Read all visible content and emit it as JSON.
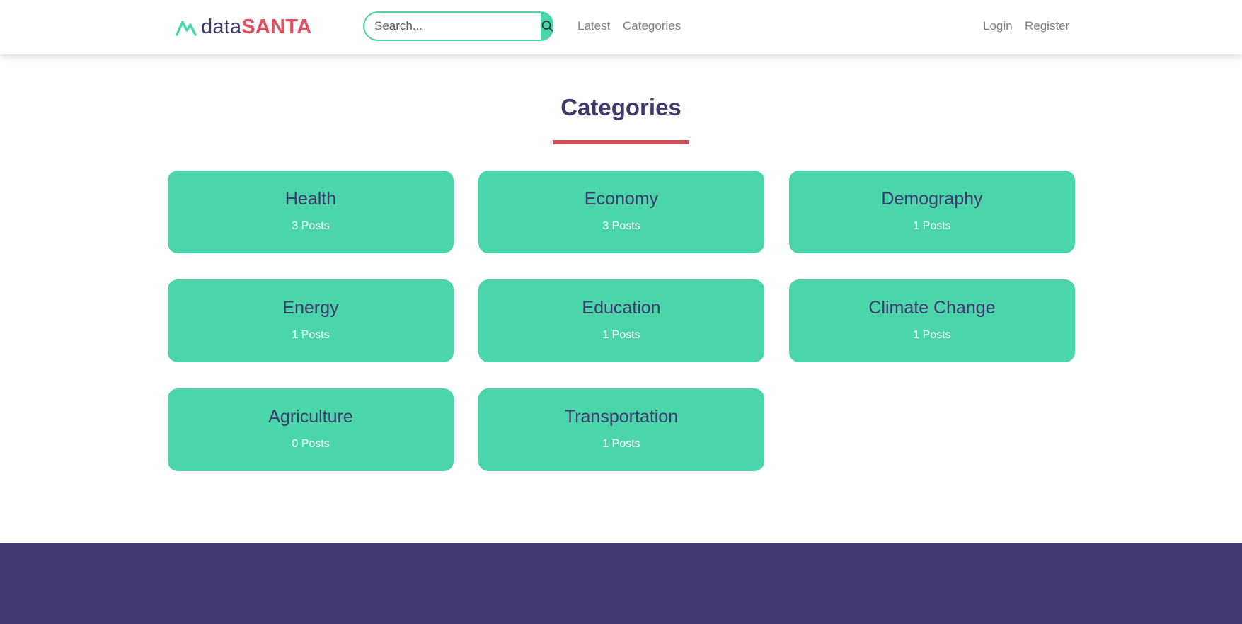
{
  "brand": {
    "name_part1": "data",
    "name_part2": "SANTA",
    "icon": "mountain-line-icon"
  },
  "search": {
    "placeholder": "Search...",
    "value": "",
    "button_icon": "search-icon"
  },
  "nav": {
    "left": [
      "Latest",
      "Categories"
    ],
    "right": [
      "Login",
      "Register"
    ]
  },
  "page": {
    "title": "Categories"
  },
  "categories": [
    {
      "name": "Health",
      "posts": "3 Posts"
    },
    {
      "name": "Economy",
      "posts": "3 Posts"
    },
    {
      "name": "Demography",
      "posts": "1 Posts"
    },
    {
      "name": "Energy",
      "posts": "1 Posts"
    },
    {
      "name": "Education",
      "posts": "1 Posts"
    },
    {
      "name": "Climate Change",
      "posts": "1 Posts"
    },
    {
      "name": "Agriculture",
      "posts": "0 Posts"
    },
    {
      "name": "Transportation",
      "posts": "1 Posts"
    }
  ],
  "colors": {
    "accent": "#4bd5ab",
    "brand_red": "#e0505e",
    "navy": "#3e3a6e",
    "footer": "#403a71"
  }
}
